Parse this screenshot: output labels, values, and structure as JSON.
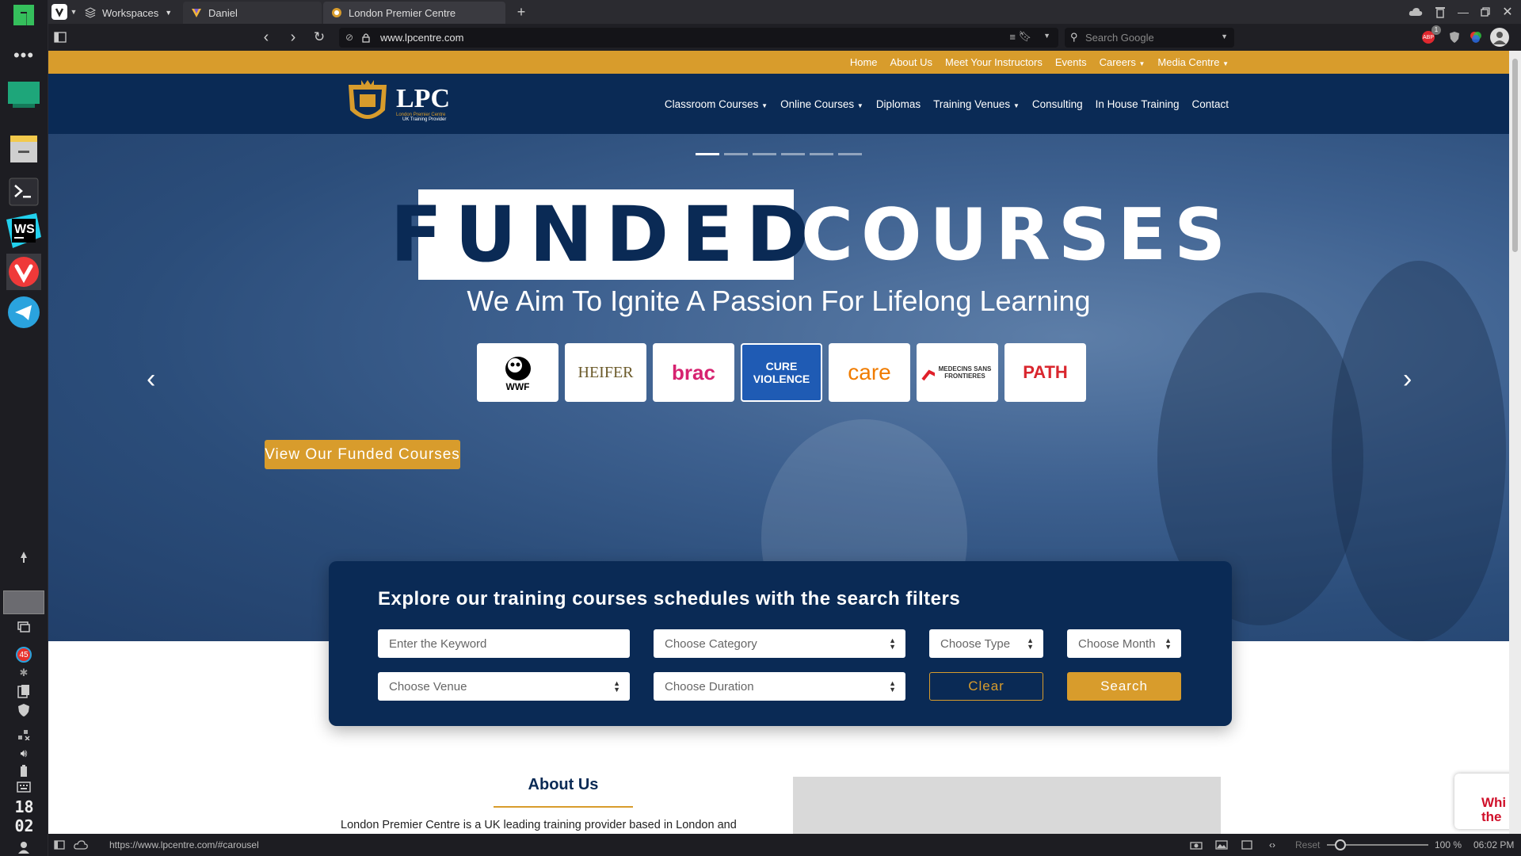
{
  "browser": {
    "workspaces_label": "Workspaces",
    "tabs": [
      {
        "label": "Daniel"
      },
      {
        "label": "London Premier Centre"
      }
    ],
    "url": "www.lpcentre.com",
    "search_placeholder": "Search Google",
    "status_url": "https://www.lpcentre.com/#carousel",
    "reset_label": "Reset",
    "zoom": "100 %",
    "time": "06:02 PM",
    "adblock_count": "1"
  },
  "dock": {
    "badge_count": "45",
    "clock_hour": "18",
    "clock_min": "02"
  },
  "site": {
    "top_links": [
      "Home",
      "About Us",
      "Meet Your Instructors",
      "Events",
      "Careers",
      "Media Centre"
    ],
    "logo_text": "LPC",
    "logo_sub": "London Premier Centre",
    "logo_sub2": "UK Training Provider",
    "nav": [
      "Classroom Courses",
      "Online Courses",
      "Diplomas",
      "Training Venues",
      "Consulting",
      "In House Training",
      "Contact"
    ],
    "hero": {
      "funded": "FUNDED",
      "courses": "COURSES",
      "tagline": "We Aim To Ignite A Passion For Lifelong Learning",
      "partners": [
        "WWF",
        "HEIFER",
        "brac",
        "CURE VIOLENCE",
        "care",
        "MEDECINS SANS FRONTIERES",
        "PATH"
      ],
      "cta": "View Our Funded Courses"
    },
    "search_panel": {
      "title": "Explore our training courses schedules with the search filters",
      "keyword_placeholder": "Enter the Keyword",
      "category": "Choose Category",
      "type": "Choose Type",
      "month": "Choose Month",
      "venue": "Choose Venue",
      "duration": "Choose Duration",
      "clear": "Clear",
      "search": "Search"
    },
    "about": {
      "heading": "About Us",
      "text": "London Premier Centre is a UK leading training provider based in London and"
    },
    "chat_text": "Whi the"
  },
  "colors": {
    "navy": "#0a2a55",
    "gold": "#d89c2c"
  }
}
